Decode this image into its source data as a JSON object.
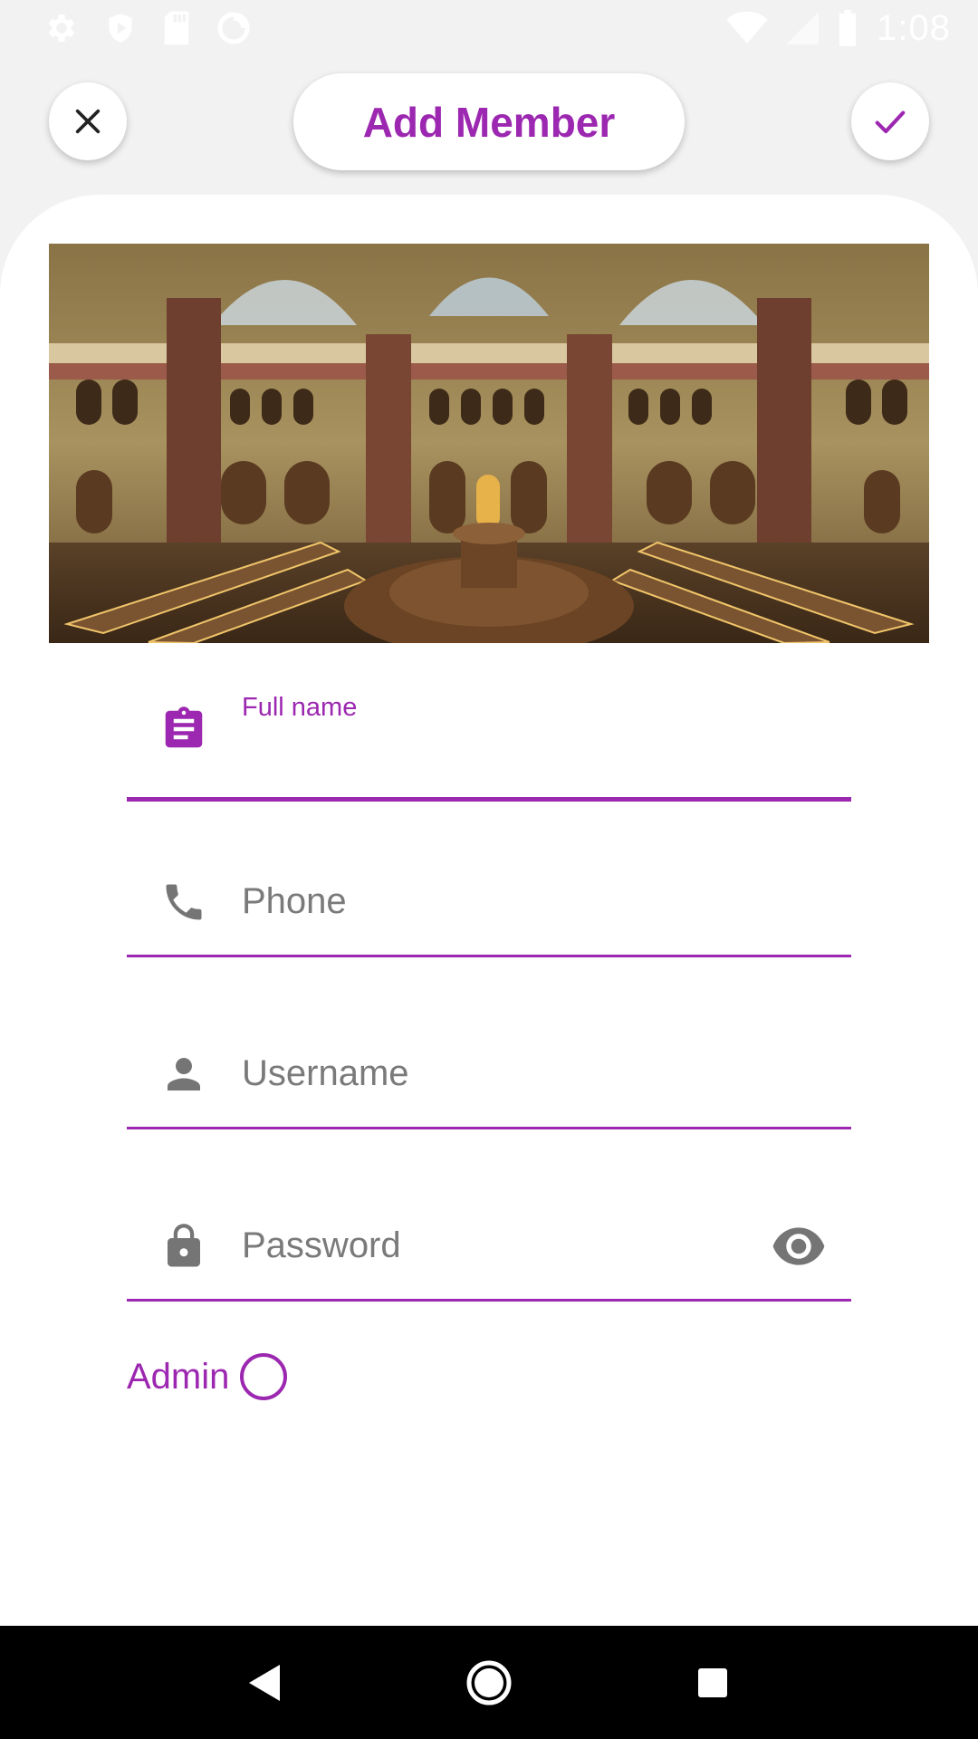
{
  "status_bar": {
    "time": "1:08",
    "left_icons": [
      "settings-icon",
      "shield-icon",
      "sd-card-icon",
      "sync-icon"
    ],
    "right_icons": [
      "wifi-icon",
      "signal-icon",
      "battery-icon"
    ]
  },
  "header": {
    "title": "Add Member",
    "close_icon": "close-icon",
    "confirm_icon": "check-icon"
  },
  "hero_image": {
    "subject": "library-reading-room"
  },
  "form": {
    "full_name": {
      "label": "Full name",
      "value": "",
      "icon": "clipboard-icon",
      "focused": true
    },
    "phone": {
      "placeholder": "Phone",
      "icon": "phone-icon"
    },
    "username": {
      "placeholder": "Username",
      "icon": "person-icon"
    },
    "password": {
      "placeholder": "Password",
      "icon": "lock-icon",
      "trailing_icon": "visibility-icon"
    },
    "admin": {
      "label": "Admin",
      "checked": false
    }
  },
  "nav_bar": {
    "buttons": [
      "back-icon",
      "home-icon",
      "recents-icon"
    ]
  },
  "colors": {
    "accent": "#9c27b0",
    "background": "#f2f2f2",
    "card": "#ffffff",
    "icon_gray": "#757575"
  }
}
